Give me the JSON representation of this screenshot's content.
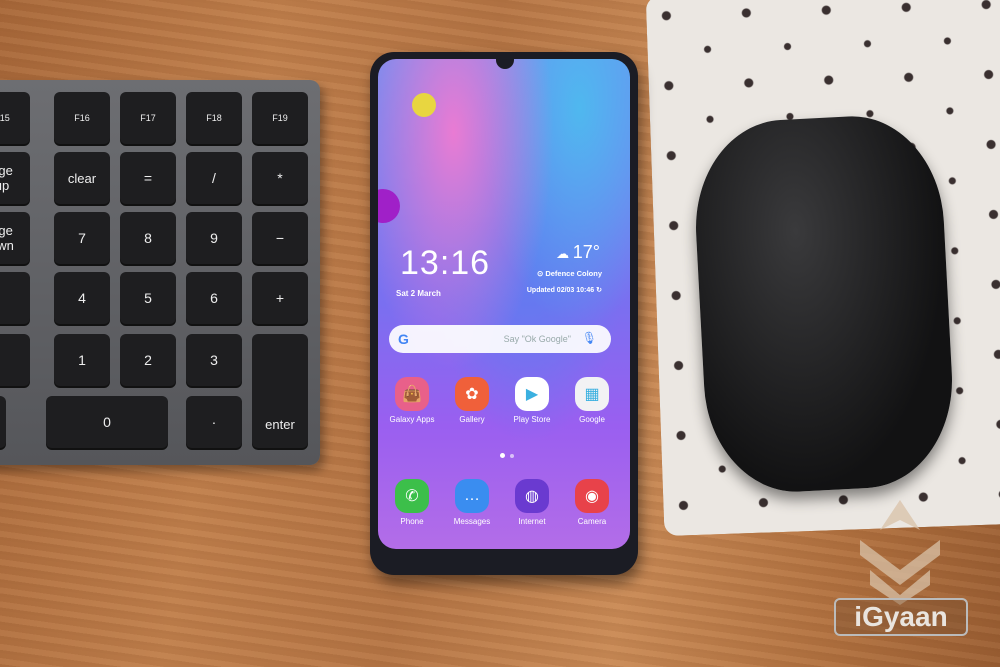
{
  "keyboard": {
    "rows": [
      [
        "F15",
        "F16",
        "F17",
        "F18",
        "F19"
      ],
      [
        "age\nup",
        "clear",
        "=",
        "/",
        "*"
      ],
      [
        "age\nown",
        "7",
        "8",
        "9",
        "−"
      ],
      [
        "",
        "4",
        "5",
        "6",
        "+"
      ],
      [
        "",
        "1",
        "2",
        "3"
      ],
      [
        "",
        "0",
        "·",
        "enter"
      ]
    ]
  },
  "phone": {
    "clock": "13:16",
    "date": "Sat 2 March",
    "weather": {
      "icon": "cloud-sun-icon",
      "temp": "17°",
      "location": "Defence Colony",
      "updated": "Updated 02/03 10:46"
    },
    "search": {
      "logo": "G",
      "placeholder": "Say \"Ok Google\""
    },
    "apps": [
      {
        "label": "Galaxy Apps",
        "icon": "shopping-bag-icon",
        "color": "#e8608a"
      },
      {
        "label": "Gallery",
        "icon": "flower-icon",
        "color": "#f0603a"
      },
      {
        "label": "Play Store",
        "icon": "play-store-icon",
        "color": "#ffffff"
      },
      {
        "label": "Google",
        "icon": "google-folder-icon",
        "color": "#f2f2f4"
      }
    ],
    "dock": [
      {
        "label": "Phone",
        "icon": "phone-icon",
        "color": "#3cbf4a"
      },
      {
        "label": "Messages",
        "icon": "messages-icon",
        "color": "#3a8df0"
      },
      {
        "label": "Internet",
        "icon": "internet-icon",
        "color": "#6a3ad0"
      },
      {
        "label": "Camera",
        "icon": "camera-icon",
        "color": "#e8424a"
      }
    ]
  },
  "watermark": "iGyaan"
}
